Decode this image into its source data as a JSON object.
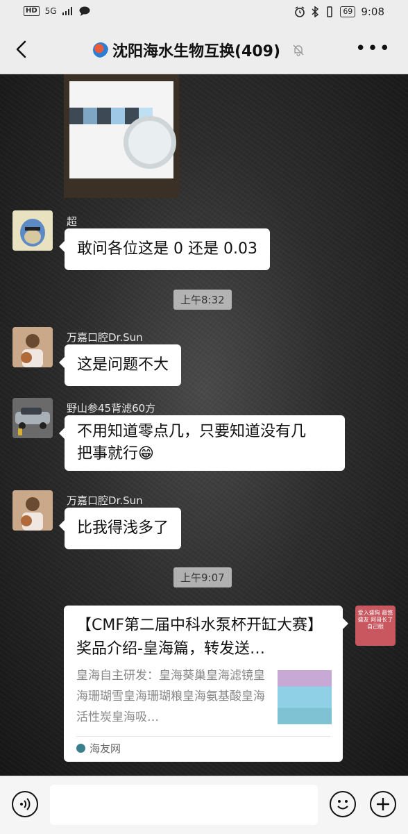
{
  "status_bar": {
    "network": "HD",
    "signal": "5G",
    "battery": "69",
    "time": "9:08"
  },
  "header": {
    "title": "沈阳海水生物互换(409)",
    "back_icon": "chevron-left-icon",
    "mute_icon": "bell-off-icon",
    "more_icon": "more-dots-icon"
  },
  "messages": [
    {
      "name": "超",
      "text": "敢问各位这是 0 还是 0.03"
    },
    {
      "time": "上午8:32"
    },
    {
      "name": "万嘉口腔Dr.Sun",
      "text": "这是问题不大"
    },
    {
      "name": "野山参45背滤60方",
      "text_line1": "不用知道零点几，只要知道没有几",
      "text_line2": "把事就行😁"
    },
    {
      "name": "万嘉口腔Dr.Sun",
      "text": "比我得浅多了"
    },
    {
      "time": "上午9:07"
    }
  ],
  "link_card": {
    "title": "【CMF第二届中科水泵杯开缸大赛】奖品介绍-皇海篇，转发送…",
    "description": "皇海自主研发：皇海葵巢皇海滤镜皇海珊瑚雪皇海珊瑚粮皇海氨基酸皇海活性炭皇海吸…",
    "source": "海友网"
  },
  "my_avatar_text": "爱入盛狗 最悠盛友 阿哥长了自己眼",
  "input_bar": {
    "voice_icon": "voice-icon",
    "emoji_icon": "emoji-icon",
    "plus_icon": "plus-icon"
  }
}
